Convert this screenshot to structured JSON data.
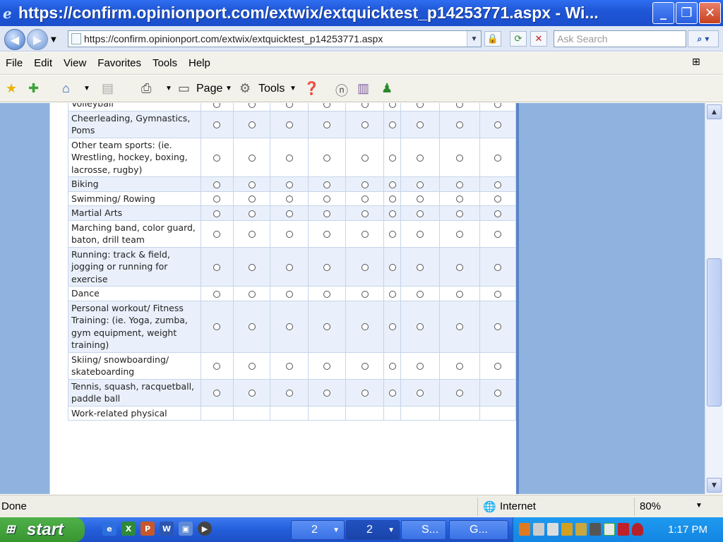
{
  "window": {
    "title": "https://confirm.opinionport.com/extwix/extquicktest_p14253771.aspx - Wi...",
    "min": "_",
    "max": "❐",
    "close": "✕"
  },
  "address": {
    "url": "https://confirm.opinionport.com/extwix/extquicktest_p14253771.aspx",
    "search_placeholder": "Ask Search"
  },
  "menu": [
    "File",
    "Edit",
    "View",
    "Favorites",
    "Tools",
    "Help"
  ],
  "commandbar": {
    "page": "Page",
    "tools": "Tools"
  },
  "survey": {
    "columns": 9,
    "rows": [
      {
        "label": "Volleyball"
      },
      {
        "label": "Cheerleading, Gymnastics, Poms"
      },
      {
        "label": "Other team sports: (ie. Wrestling, hockey, boxing, lacrosse, rugby)"
      },
      {
        "label": "Biking"
      },
      {
        "label": "Swimming/ Rowing"
      },
      {
        "label": "Martial Arts"
      },
      {
        "label": "Marching band, color guard, baton, drill team"
      },
      {
        "label": "Running: track & field, jogging or running for exercise"
      },
      {
        "label": "Dance"
      },
      {
        "label": "Personal workout/ Fitness Training: (ie. Yoga, zumba, gym equipment, weight training)"
      },
      {
        "label": "Skiing/ snowboarding/ skateboarding"
      },
      {
        "label": "Tennis, squash, racquetball, paddle ball"
      },
      {
        "label": "Work-related physical"
      }
    ]
  },
  "status": {
    "text": "Done",
    "zone": "Internet",
    "zoom": "80%"
  },
  "taskbar": {
    "start": "start",
    "tasks": [
      {
        "label": "2",
        "active": false
      },
      {
        "label": "2",
        "active": true
      },
      {
        "label": "S...",
        "active": false
      },
      {
        "label": "G...",
        "active": false
      }
    ],
    "clock": "1:17 PM"
  }
}
